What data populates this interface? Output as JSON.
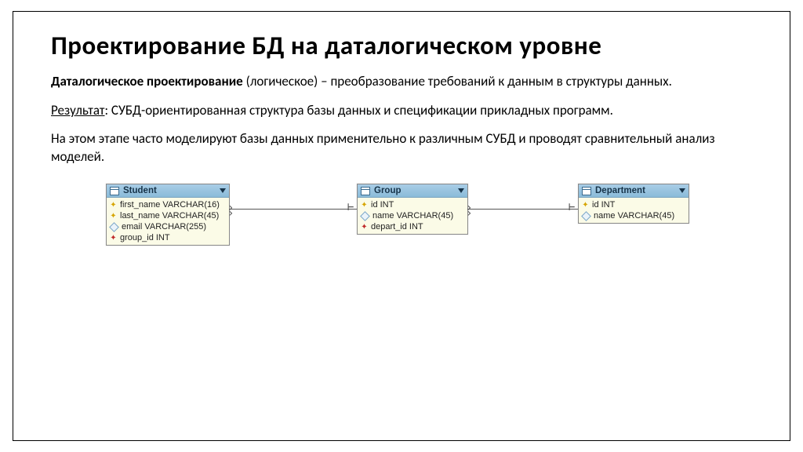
{
  "title": "Проектирование БД на даталогическом уровне",
  "para1_term": "Даталогическое проектирование",
  "para1_rest": " (логическое) – преобразование требований к данным в структуры данных.",
  "para2_label": "Результат",
  "para2_rest": ": СУБД-ориентированная структура базы данных и спецификации прикладных программ.",
  "para3": "На этом этапе часто моделируют базы данных применительно к различным СУБД и проводят сравнительный анализ моделей.",
  "entities": {
    "student": {
      "name": "Student",
      "cols": [
        {
          "icon": "key",
          "text": "first_name VARCHAR(16)"
        },
        {
          "icon": "key",
          "text": "last_name VARCHAR(45)"
        },
        {
          "icon": "dia",
          "text": "email VARCHAR(255)"
        },
        {
          "icon": "keyred",
          "text": "group_id INT"
        }
      ]
    },
    "group": {
      "name": "Group",
      "cols": [
        {
          "icon": "key",
          "text": "id INT"
        },
        {
          "icon": "dia",
          "text": "name VARCHAR(45)"
        },
        {
          "icon": "keyred",
          "text": "depart_id INT"
        }
      ]
    },
    "department": {
      "name": "Department",
      "cols": [
        {
          "icon": "key",
          "text": "id INT"
        },
        {
          "icon": "dia",
          "text": "name VARCHAR(45)"
        }
      ]
    }
  }
}
